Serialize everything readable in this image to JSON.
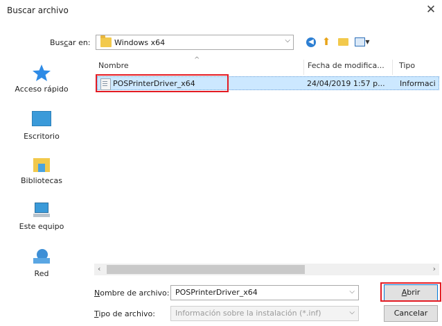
{
  "dialog": {
    "title": "Buscar archivo",
    "close_icon": "close-icon"
  },
  "lookin": {
    "label_pre": "Bus",
    "label_u": "c",
    "label_post": "ar en:",
    "value": "Windows x64"
  },
  "toolbar": {
    "icons": [
      "back-icon",
      "up-folder-icon",
      "new-folder-icon",
      "view-menu-icon"
    ]
  },
  "places": [
    {
      "label": "Acceso rápido",
      "icon": "star-icon"
    },
    {
      "label": "Escritorio",
      "icon": "desktop-icon"
    },
    {
      "label": "Bibliotecas",
      "icon": "libraries-icon"
    },
    {
      "label": "Este equipo",
      "icon": "computer-icon"
    },
    {
      "label": "Red",
      "icon": "network-icon"
    }
  ],
  "columns": {
    "name": "Nombre",
    "date": "Fecha de modifica...",
    "type": "Tipo"
  },
  "files": [
    {
      "name": "POSPrinterDriver_x64",
      "date": "24/04/2019 1:57 p...",
      "type": "Informaci"
    }
  ],
  "filename": {
    "label_u": "N",
    "label_post": "ombre de archivo:",
    "value": "POSPrinterDriver_x64"
  },
  "filetype": {
    "label_u": "T",
    "label_post": "ipo de archivo:",
    "value": "Información sobre la instalación (*.inf)"
  },
  "buttons": {
    "open_u": "A",
    "open_post": "brir",
    "cancel": "Cancelar"
  },
  "colors": {
    "highlight": "#e31b23",
    "selection": "#cce8ff"
  }
}
